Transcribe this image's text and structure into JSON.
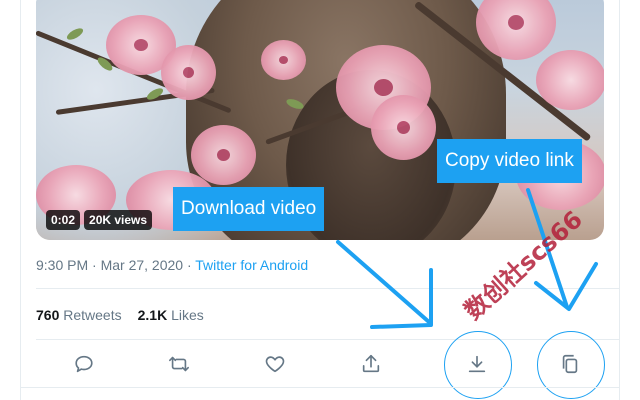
{
  "video": {
    "duration": "0:02",
    "views": "20K views"
  },
  "tweet_meta": {
    "timestamp": "9:30 PM · Mar 27, 2020",
    "separator": " · ",
    "source": "Twitter for Android"
  },
  "stats": {
    "retweets_count": "760",
    "retweets_label": "Retweets",
    "likes_count": "2.1K",
    "likes_label": "Likes"
  },
  "actions": [
    {
      "icon": "reply-icon"
    },
    {
      "icon": "retweet-icon"
    },
    {
      "icon": "heart-icon"
    },
    {
      "icon": "share-icon"
    },
    {
      "icon": "download-icon"
    },
    {
      "icon": "copy-icon"
    }
  ],
  "callouts": {
    "download": "Download video",
    "copy_link": "Copy video link"
  },
  "watermark": "数创社scs66",
  "colors": {
    "accent": "#1da1f2",
    "text_secondary": "#657786",
    "text_primary": "#14171a",
    "border": "#e6ecf0",
    "watermark": "#b3203a"
  }
}
